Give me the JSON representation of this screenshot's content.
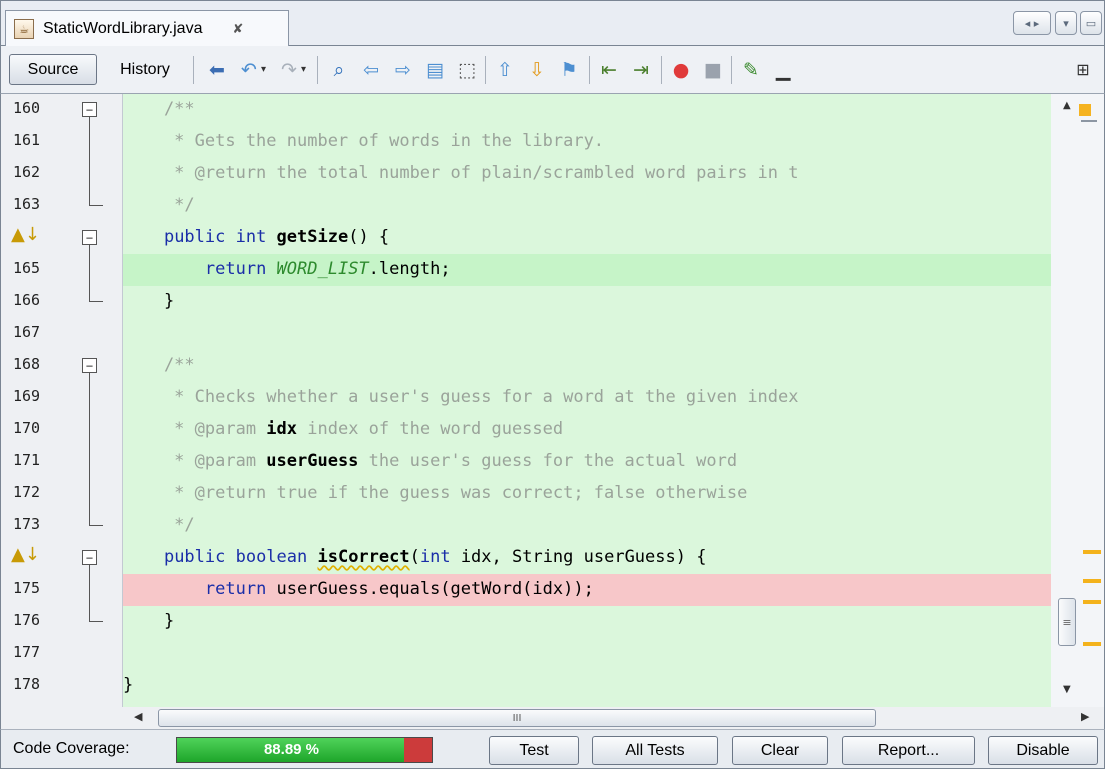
{
  "tab": {
    "file_type_glyph": "☕",
    "file_name": "StaticWordLibrary.java",
    "close_glyph": "✘"
  },
  "window_controls": {
    "nav_glyph": "◂ ▸",
    "dropdown_glyph": "▾",
    "maximize_glyph": "▭"
  },
  "toolbar": {
    "source_label": "Source",
    "history_label": "History",
    "expand_glyph": "⊞"
  },
  "code": {
    "lines": [
      {
        "num": "160",
        "fold": "−"
      },
      {
        "num": "161"
      },
      {
        "num": "162"
      },
      {
        "num": "163"
      },
      {
        "num": "",
        "marker_glyph": "▲↓",
        "fold": "−"
      },
      {
        "num": "165",
        "coverage": "covered"
      },
      {
        "num": "166"
      },
      {
        "num": "167"
      },
      {
        "num": "168",
        "fold": "−"
      },
      {
        "num": "169"
      },
      {
        "num": "170"
      },
      {
        "num": "171"
      },
      {
        "num": "172"
      },
      {
        "num": "173"
      },
      {
        "num": "",
        "marker_glyph": "▲↓",
        "fold": "−"
      },
      {
        "num": "175",
        "coverage": "uncovered"
      },
      {
        "num": "176"
      },
      {
        "num": "177"
      },
      {
        "num": "178"
      }
    ],
    "text": {
      "l160": "    /**",
      "l161": "     * Gets the number of words in the library.",
      "l162": "     * @return the total number of plain/scrambled word pairs in t",
      "l163": "     */",
      "l164_indent": "    ",
      "l164_kw": "public int ",
      "l164_fn": "getSize",
      "l164_rest": "() {",
      "l165_indent": "        ",
      "l165_kw": "return ",
      "l165_const": "WORD_LIST",
      "l165_rest": ".length;",
      "l166": "    }",
      "l168": "    /**",
      "l169": "     * Checks whether a user's guess for a word at the given index",
      "l170_pre": "     * @param ",
      "l170_name": "idx",
      "l170_post": " index of the word guessed",
      "l171_pre": "     * @param ",
      "l171_name": "userGuess",
      "l171_post": " the user's guess for the actual word",
      "l172": "     * @return true if the guess was correct; false otherwise",
      "l173": "     */",
      "l174_indent": "    ",
      "l174_kw": "public boolean ",
      "l174_fn": "isCorrect",
      "l174_p1": "(",
      "l174_kw2": "int",
      "l174_rest": " idx, String userGuess) {",
      "l175_indent": "        ",
      "l175_kw": "return ",
      "l175_rest": "userGuess.equals(getWord(idx));",
      "l176": "    }",
      "l178": "}"
    }
  },
  "scrollbars": {
    "up_glyph": "▲",
    "down_glyph": "▼",
    "left_glyph": "◀",
    "right_glyph": "▶",
    "hthumb_grip": "III",
    "vthumb_grip": "≡"
  },
  "coverage": {
    "label": "Code Coverage:",
    "percent_text": "88.89 %",
    "fraction": 0.8889,
    "fill_color": "#22b02e",
    "miss_color": "#cc3b3b",
    "buttons": {
      "test": "Test",
      "all_tests": "All Tests",
      "clear": "Clear",
      "report": "Report...",
      "disable": "Disable"
    }
  },
  "colors": {
    "covered_line": "#c6f4c8",
    "uncovered_line": "#f7c7c9",
    "editor_background": "#dbf7dc",
    "keyword": "#1a2ea8",
    "comment": "#9aa39a",
    "constant": "#2d8a2d"
  }
}
